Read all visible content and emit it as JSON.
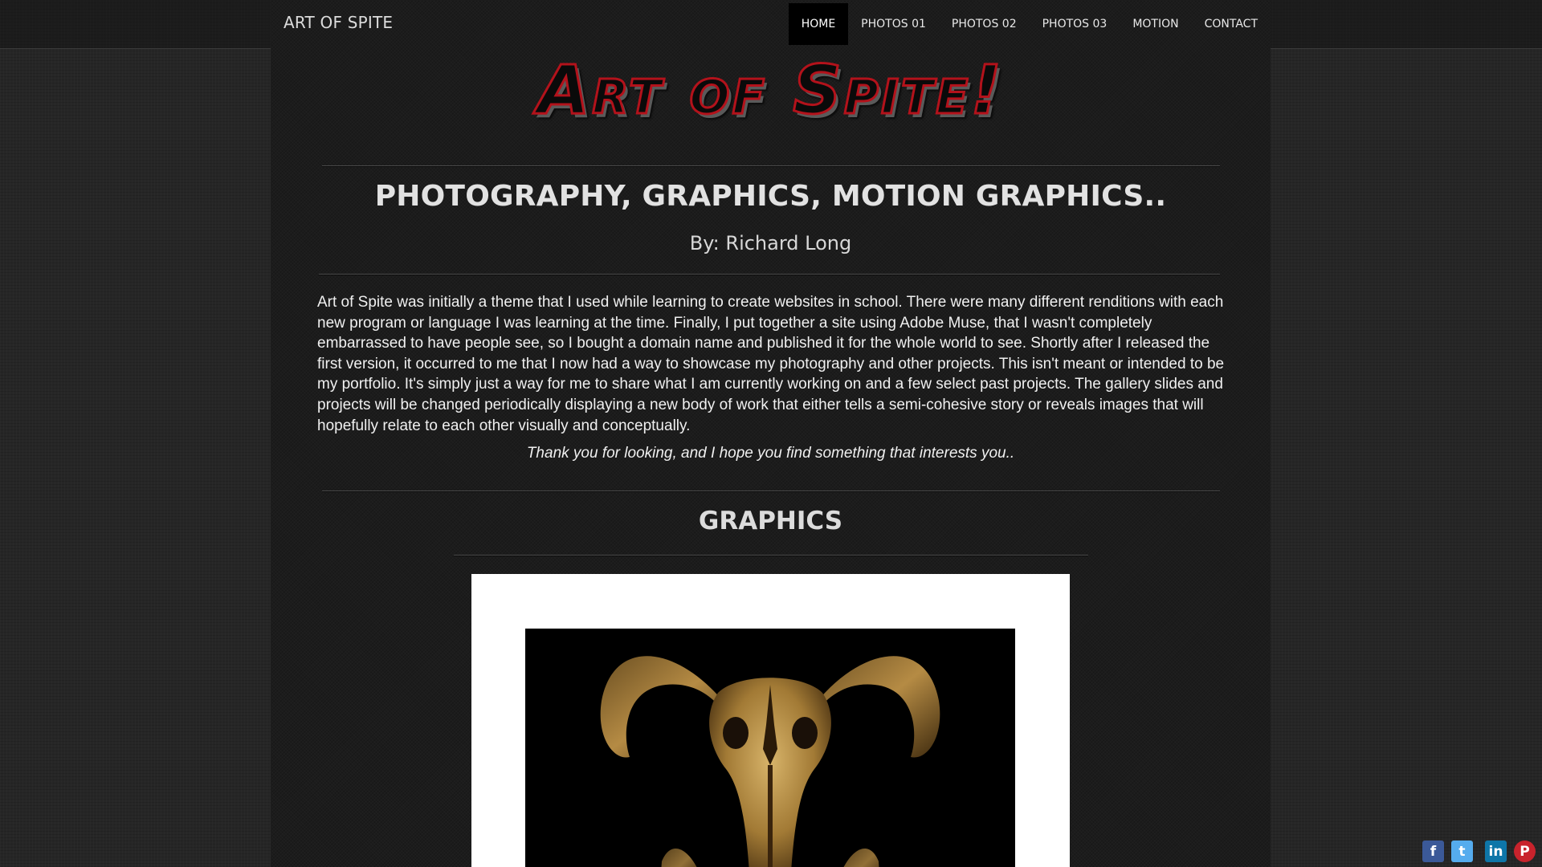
{
  "header": {
    "brand": "ART OF SPITE",
    "nav": [
      {
        "label": "HOME",
        "active": true
      },
      {
        "label": "PHOTOS 01",
        "active": false
      },
      {
        "label": "PHOTOS 02",
        "active": false
      },
      {
        "label": "PHOTOS 03",
        "active": false
      },
      {
        "label": "MOTION",
        "active": false
      },
      {
        "label": "CONTACT",
        "active": false
      }
    ]
  },
  "hero": {
    "logo_text": "Art of Spite!",
    "headline": "PHOTOGRAPHY, GRAPHICS, MOTION GRAPHICS..",
    "byline": "By: Richard Long"
  },
  "intro": {
    "paragraph": "Art of Spite was initially a theme that I used while learning to create websites in school. There were many different renditions with each new program or language I was learning at the time. Finally, I put together a site using Adobe Muse, that I wasn't completely embarrassed to have people see, so I bought a domain name and published it for the whole world to see. Shortly after I released the first version, it occurred to me that I now had a way to showcase my photography and other projects. This isn't meant or intended to be my portfolio. It's simply just a way for me to share what I am currently working on and a few select past projects. The gallery slides and projects will be changed periodically displaying a new body of work that either tells a semi-cohesive story or reveals images that will hopefully relate to each other visually and conceptually.",
    "thanks": "Thank you for looking, and I hope you find something that interests you.."
  },
  "graphics": {
    "title": "GRAPHICS"
  },
  "social": [
    {
      "name": "facebook-icon",
      "glyph": "f"
    },
    {
      "name": "twitter-icon",
      "glyph": "t"
    },
    {
      "name": "linkedin-icon",
      "glyph": "in"
    },
    {
      "name": "pinterest-icon",
      "glyph": "P"
    }
  ],
  "colors": {
    "background": "#262626",
    "page": "#1c1c1c",
    "nav_active": "#000000",
    "logo_outline": "#b3121b"
  }
}
